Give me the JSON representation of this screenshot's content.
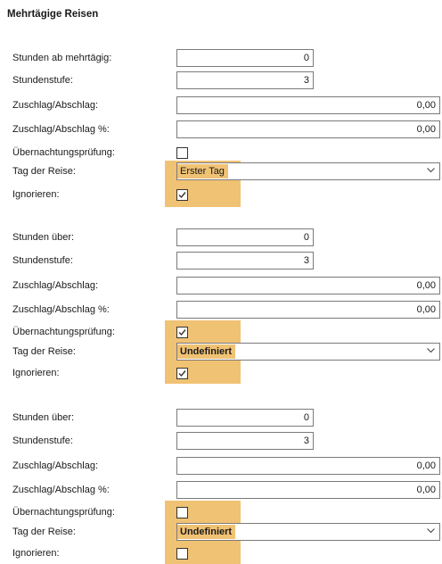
{
  "title": "Mehrtägige Reisen",
  "groups": [
    {
      "hours_label": "Stunden ab mehrtägig:",
      "hours_value": "0",
      "level_label": "Stundenstufe:",
      "level_value": "3",
      "surcharge_label": "Zuschlag/Abschlag:",
      "surcharge_value": "0,00",
      "surcharge_pct_label": "Zuschlag/Abschlag %:",
      "surcharge_pct_value": "0,00",
      "overnight_label": "Übernachtungsprüfung:",
      "overnight_checked": false,
      "day_label": "Tag der Reise:",
      "day_value": "Erster Tag",
      "ignore_label": "Ignorieren:",
      "ignore_checked": true
    },
    {
      "hours_label": "Stunden über:",
      "hours_value": "0",
      "level_label": "Stundenstufe:",
      "level_value": "3",
      "surcharge_label": "Zuschlag/Abschlag:",
      "surcharge_value": "0,00",
      "surcharge_pct_label": "Zuschlag/Abschlag %:",
      "surcharge_pct_value": "0,00",
      "overnight_label": "Übernachtungsprüfung:",
      "overnight_checked": true,
      "day_label": "Tag der Reise:",
      "day_value": "Undefiniert",
      "ignore_label": "Ignorieren:",
      "ignore_checked": true
    },
    {
      "hours_label": "Stunden über:",
      "hours_value": "0",
      "level_label": "Stundenstufe:",
      "level_value": "3",
      "surcharge_label": "Zuschlag/Abschlag:",
      "surcharge_value": "0,00",
      "surcharge_pct_label": "Zuschlag/Abschlag %:",
      "surcharge_pct_value": "0,00",
      "overnight_label": "Übernachtungsprüfung:",
      "overnight_checked": false,
      "day_label": "Tag der Reise:",
      "day_value": "Undefiniert",
      "ignore_label": "Ignorieren:",
      "ignore_checked": false
    }
  ],
  "colors": {
    "highlight": "#f0c274",
    "border": "#7a7a7a"
  }
}
